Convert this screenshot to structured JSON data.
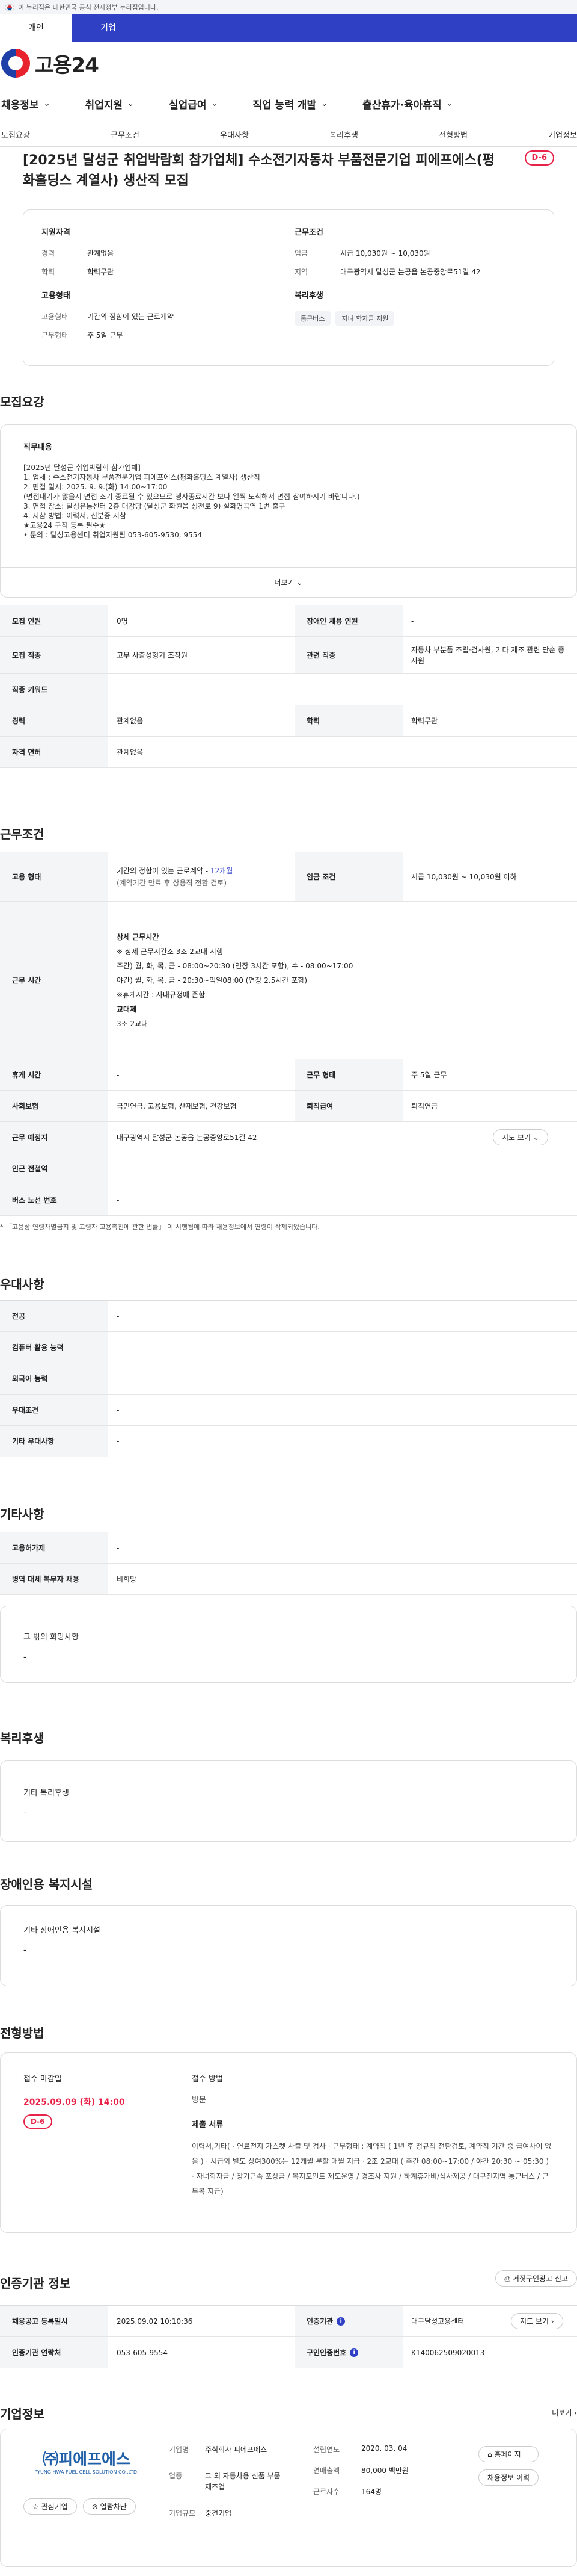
{
  "gov_banner": "이 누리집은 대한민국 공식 전자정부 누리집입니다.",
  "user_tabs": [
    "개인",
    "기업"
  ],
  "logo": "고용24",
  "gnb": [
    "채용정보",
    "취업지원",
    "실업급여",
    "직업 능력 개발",
    "출산휴가·육아휴직"
  ],
  "snb": [
    "모집요강",
    "근무조건",
    "우대사항",
    "복리후생",
    "전형방법",
    "기업정보"
  ],
  "job": {
    "title": "[2025년 달성군 취업박람회 참가업체] 수소전기자동차 부품전문기업 피에프에스(평화홀딩스 계열사) 생산직 모집",
    "dday": "D-6",
    "summary": {
      "qual_h": "지원자격",
      "cond_h": "근무조건",
      "emp_h": "고용형태",
      "welfare_h": "복리후생",
      "career_k": "경력",
      "career_v": "관계없음",
      "edu_k": "학력",
      "edu_v": "학력무관",
      "wage_k": "임금",
      "wage_v": "시급 10,030원 ~ 10,030원",
      "region_k": "지역",
      "region_v": "대구광역시 달성군 논공읍 논공중앙로51길 42",
      "etype_k": "고용형태",
      "etype_v": "기간의 정함이 있는 근로계약",
      "wform_k": "근무형태",
      "wform_v": "주 5일 근무",
      "tags": [
        "통근버스",
        "자녀 학자금 지원"
      ]
    }
  },
  "recruit": {
    "h": "모집요강",
    "duty_h": "직무내용",
    "duty": [
      "[2025년 달성군 취업박람회 참가업체]",
      "1. 업체 :  수소전기자동차 부품전문기업 피에프에스(평화홀딩스 계열사) 생산직",
      "2. 면접 일시: 2025. 9. 9.(화) 14:00~17:00",
      "   (면접대기가 많을시 면접 조기 종료될 수 있으므로 행사종료시간 보다 일찍 도착해서 면접 참여하시기 바랍니다.)",
      "3. 면접 장소: 달성유통센터 2층 대강당 (달성군 화원읍 성천로 9) 설화명곡역 1번 출구",
      "4. 지참 방법: 이력서, 신분증 지참",
      "★고용24 구직 등록 필수★",
      "• 문의 : 달성고용센터 취업지원팀 053-605-9530, 9554"
    ],
    "more": "더보기",
    "rows": [
      [
        "모집 인원",
        "0명",
        "장애인 채용 인원",
        "-"
      ],
      [
        "모집 직종",
        "고무 사출성형기 조작원",
        "관련 직종",
        "자동차 부분품 조립·검사원, 기타 제조 관련 단순 종사원"
      ],
      [
        "직종 키워드",
        "-"
      ],
      [
        "경력",
        "관계없음",
        "학력",
        "학력무관"
      ],
      [
        "자격 면허",
        "관계없음"
      ]
    ]
  },
  "cond": {
    "h": "근무조건",
    "etype_k": "고용 형태",
    "etype_v1": "기간의 정함이 있는 근로계약 - ",
    "etype_v2": "12개월",
    "etype_v3": "(계약기간 만료 후 상용직 전환 검토)",
    "wage_k": "임금 조건",
    "wage_v": "시급 10,030원 ~ 10,030원 이하",
    "time_k": "근무 시간",
    "time": [
      "상세 근무시간",
      "※ 상세 근무시간조 3조 2교대 시행",
      "주간) 월, 화, 목, 금 - 08:00~20:30 (연장 3시간 포함), 수 - 08:00~17:00",
      "야간) 월, 화, 목, 금 - 20:30~익일08:00 (연장 2.5시간 포함)",
      "※휴게시간 : 사내규정에 준함",
      "교대제",
      "3조 2교대"
    ],
    "rows": [
      [
        "휴게 시간",
        "-",
        "근무 형태",
        "주 5일 근무"
      ],
      [
        "사회보험",
        "국민연금, 고용보험, 산재보험, 건강보험",
        "퇴직급여",
        "퇴직연금"
      ]
    ],
    "place_k": "근무 예정지",
    "place_v": "대구광역시 달성군 논공읍 논공중앙로51길 42",
    "map_btn": "지도 보기",
    "rows2": [
      [
        "인근 전철역",
        "-"
      ],
      [
        "버스 노선 번호",
        "-"
      ]
    ],
    "note": "* 「고용상 연령차별금지 및 고령자 고용촉진에 관한 법률」 이 시행됨에 따라 채용정보에서 연령이 삭제되었습니다."
  },
  "pref": {
    "h": "우대사항",
    "rows": [
      [
        "전공",
        "-"
      ],
      [
        "컴퓨터 활용 능력",
        "-"
      ],
      [
        "외국어 능력",
        "-"
      ],
      [
        "우대조건",
        "-"
      ],
      [
        "기타 우대사항",
        "-"
      ]
    ]
  },
  "etc": {
    "h": "기타사항",
    "rows": [
      [
        "고용허가제",
        "-"
      ],
      [
        "병역 대체 복무자 채용",
        "비희망"
      ]
    ],
    "wish_h": "그 밖의 희망사항",
    "wish_v": "-"
  },
  "welfare": {
    "h": "복리후생",
    "sub": "기타 복리후생",
    "v": "-"
  },
  "disab": {
    "h": "장애인용 복지시설",
    "sub": "기타 장애인용 복지시설",
    "v": "-"
  },
  "process": {
    "h": "전형방법",
    "deadline_k": "접수 마감일",
    "deadline_v": "2025.09.09 (화) 14:00",
    "dday": "D-6",
    "method_k": "접수 방법",
    "method_v": "방문",
    "docs_k": "제출 서류",
    "docs": "이력서,기타( · 연료전지 가스켓 사출 및 검사 · 근무형태 : 계약직 ( 1년 후 정규직 전환검토, 계약직 기간 중 급여차이 없음 ) · 시급외 별도 상여300%는 12개월 분할 매월 지급 · 2조 2교대 ( 주간 08:00~17:00 / 야간 20:30 ~ 05:30 ) · 자녀학자금 / 장기근속 포상금 / 복지포인트 제도운영 / 경조사 지원 / 하계휴가비/식사제공 / 대구전지역 통근버스 / 근무복 지급)"
  },
  "agency": {
    "h": "인증기관 정보",
    "report_btn": "거짓구인광고 신고",
    "reg_k": "채용공고 등록일시",
    "reg_v": "2025.09.02 10:10:36",
    "org_k": "인증기관",
    "org_v": "대구달성고용센터",
    "map_btn": "지도 보기",
    "tel_k": "인증기관 연락처",
    "tel_v": "053-605-9554",
    "no_k": "구인인증번호",
    "no_v": "K140062509020013"
  },
  "company": {
    "h": "기업정보",
    "more": "더보기",
    "logo_main": "㈜피에프에스",
    "logo_sub": "PYUNG HWA FUEL CELL SOLUTION CO.,LTD.",
    "fav_btn": "관심기업",
    "block_btn": "열람차단",
    "name_k": "기업명",
    "name_v": "주식회사 피에프에스",
    "ind_k": "업종",
    "ind_v": "그 외 자동차용 신품 부품 제조업",
    "size_k": "기업규모",
    "size_v": "중견기업",
    "est_k": "설립연도",
    "est_v": "2020. 03. 04",
    "sales_k": "연매출액",
    "sales_v": "80,000 백만원",
    "emp_k": "근로자수",
    "emp_v": "164명",
    "home_btn": "홈페이지",
    "hist_btn": "채용정보 이력"
  }
}
